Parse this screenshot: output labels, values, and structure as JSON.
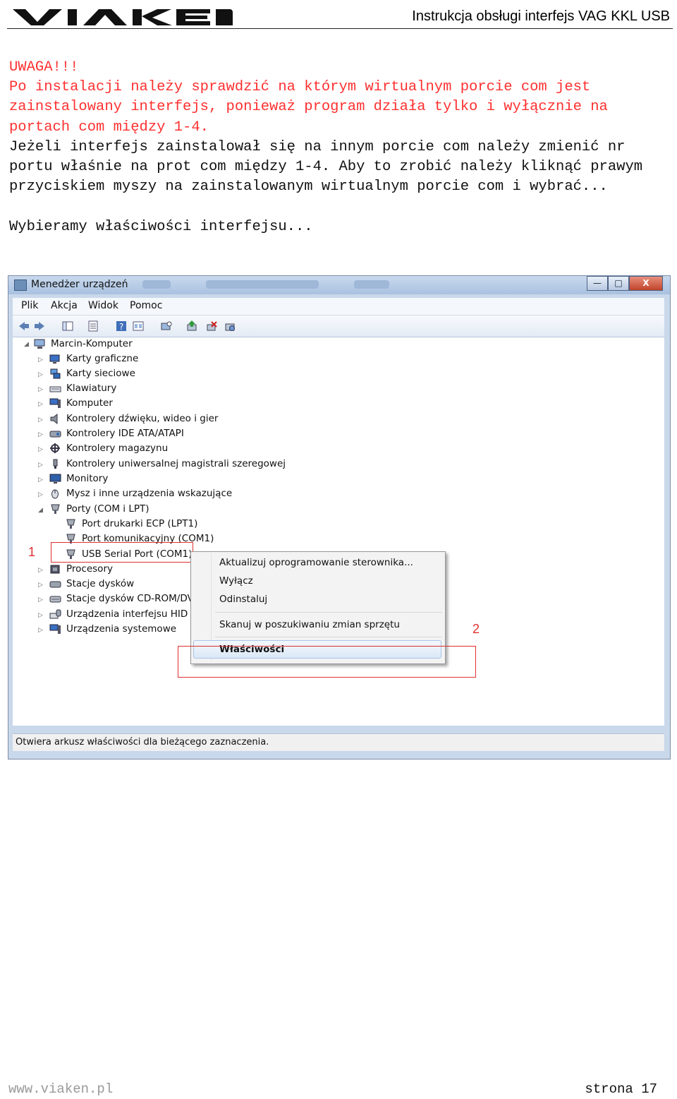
{
  "header": {
    "logo_text": "VIAKEN",
    "doc_title": "Instrukcja obsługi interfejs VAG KKL USB"
  },
  "text": {
    "warning": "UWAGA!!!",
    "red_paragraph": "Po instalacji należy sprawdzić na którym wirtualnym porcie com jest zainstalowany interfejs, ponieważ program działa tylko i wyłącznie na portach com między 1-4.",
    "black_paragraph": "Jeżeli interfejs zainstalował się na innym porcie com należy zmienić nr portu właśnie na prot com między 1-4. Aby to zrobić należy kliknąć prawym przyciskiem myszy na zainstalowanym wirtualnym porcie com i wybrać...",
    "choose": "Wybieramy właściwości interfejsu..."
  },
  "window": {
    "title": "Menedżer urządzeń",
    "buttons": {
      "minimize": "—",
      "maximize": "□",
      "close": "X"
    },
    "menu": [
      "Plik",
      "Akcja",
      "Widok",
      "Pomoc"
    ],
    "toolbar_icons": [
      "back-icon",
      "forward-icon",
      "console-tree-icon",
      "properties-icon",
      "help-icon",
      "view-icon",
      "scan-icon",
      "update-driver-icon",
      "disable-icon",
      "uninstall-icon"
    ],
    "tree": {
      "root": "Marcin-Komputer",
      "categories": [
        "Karty graficzne",
        "Karty sieciowe",
        "Klawiatury",
        "Komputer",
        "Kontrolery dźwięku, wideo i gier",
        "Kontrolery IDE ATA/ATAPI",
        "Kontrolery magazynu",
        "Kontrolery uniwersalnej magistrali szeregowej",
        "Monitory",
        "Mysz i inne urządzenia wskazujące",
        "Porty (COM i LPT)"
      ],
      "ports": [
        "Port drukarki ECP (LPT1)",
        "Port komunikacyjny (COM1)",
        "USB Serial Port (COM1)"
      ],
      "categories_after": [
        "Procesory",
        "Stacje dysków",
        "Stacje dysków CD-ROM/DV",
        "Urządzenia interfejsu HID",
        "Urządzenia systemowe"
      ]
    },
    "context_menu": {
      "update": "Aktualizuj oprogramowanie sterownika...",
      "disable": "Wyłącz",
      "uninstall": "Odinstaluj",
      "scan": "Skanuj w poszukiwaniu zmian sprzętu",
      "properties": "Właściwości"
    },
    "annotations": {
      "one": "1",
      "two": "2"
    },
    "status": "Otwiera arkusz właściwości dla bieżącego zaznaczenia."
  },
  "footer": {
    "website": "www.viaken.pl",
    "page": "strona 17"
  },
  "colors": {
    "warning_red": "#ff3030",
    "annotation_red": "#e03030"
  }
}
